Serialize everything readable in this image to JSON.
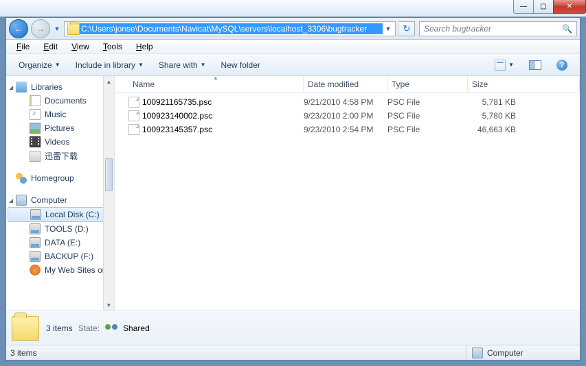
{
  "titlebar": {
    "min": "—",
    "max": "▢",
    "close": "✕"
  },
  "nav": {
    "path": "C:\\Users\\jonse\\Documents\\Navicat\\MySQL\\servers\\localhost_3306\\bugtracker",
    "search_placeholder": "Search bugtracker"
  },
  "menu": {
    "file": "File",
    "edit": "Edit",
    "view": "View",
    "tools": "Tools",
    "help": "Help"
  },
  "toolbar": {
    "organize": "Organize",
    "include": "Include in library",
    "share": "Share with",
    "newfolder": "New folder"
  },
  "sidebar": {
    "libraries": "Libraries",
    "documents": "Documents",
    "music": "Music",
    "pictures": "Pictures",
    "videos": "Videos",
    "xunlei": "迅雷下载",
    "homegroup": "Homegroup",
    "computer": "Computer",
    "localdisk": "Local Disk (C:)",
    "tools": "TOOLS (D:)",
    "data": "DATA (E:)",
    "backup": "BACKUP (F:)",
    "myweb": "My Web Sites on"
  },
  "columns": {
    "name": "Name",
    "date": "Date modified",
    "type": "Type",
    "size": "Size"
  },
  "files": [
    {
      "name": "100921165735.psc",
      "date": "9/21/2010 4:58 PM",
      "type": "PSC File",
      "size": "5,781 KB"
    },
    {
      "name": "100923140002.psc",
      "date": "9/23/2010 2:00 PM",
      "type": "PSC File",
      "size": "5,780 KB"
    },
    {
      "name": "100923145357.psc",
      "date": "9/23/2010 2:54 PM",
      "type": "PSC File",
      "size": "46,663 KB"
    }
  ],
  "details": {
    "count": "3 items",
    "state_lbl": "State:",
    "state_val": "Shared"
  },
  "status": {
    "left": "3 items",
    "right": "Computer"
  }
}
